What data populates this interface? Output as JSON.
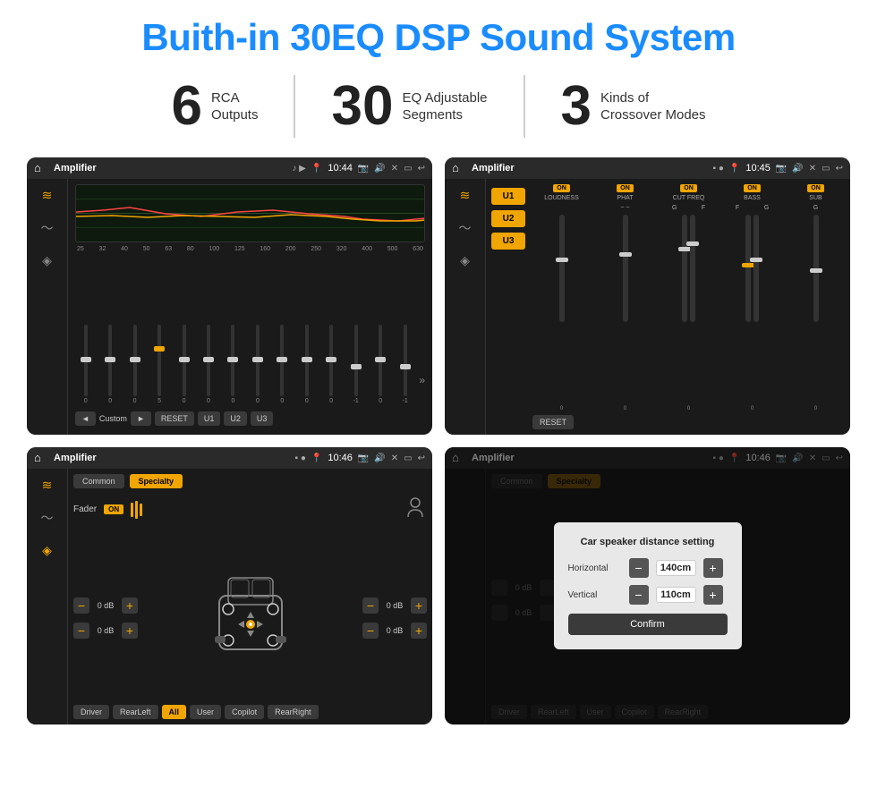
{
  "page": {
    "title": "Buith-in 30EQ DSP Sound System",
    "stats": [
      {
        "number": "6",
        "label": "RCA\nOutputs"
      },
      {
        "number": "30",
        "label": "EQ Adjustable\nSegments"
      },
      {
        "number": "3",
        "label": "Kinds of\nCrossover Modes"
      }
    ]
  },
  "screen1": {
    "statusTitle": "Amplifier",
    "time": "10:44",
    "freqLabels": [
      "25",
      "32",
      "40",
      "50",
      "63",
      "80",
      "100",
      "125",
      "160",
      "200",
      "250",
      "320",
      "400",
      "500",
      "630"
    ],
    "sliderValues": [
      "0",
      "0",
      "0",
      "5",
      "0",
      "0",
      "0",
      "0",
      "0",
      "0",
      "0",
      "-1",
      "0",
      "-1"
    ],
    "buttons": [
      "◄",
      "Custom",
      "►",
      "RESET",
      "U1",
      "U2",
      "U3"
    ]
  },
  "screen2": {
    "statusTitle": "Amplifier",
    "time": "10:45",
    "presets": [
      "U1",
      "U2",
      "U3"
    ],
    "channels": [
      "LOUDNESS",
      "PHAT",
      "CUT FREQ",
      "BASS",
      "SUB"
    ],
    "toggleState": "ON",
    "resetBtn": "RESET"
  },
  "screen3": {
    "statusTitle": "Amplifier",
    "time": "10:46",
    "tabs": [
      "Common",
      "Specialty"
    ],
    "activeTab": "Specialty",
    "faderLabel": "Fader",
    "faderOn": "ON",
    "dbValues": [
      "0 dB",
      "0 dB",
      "0 dB",
      "0 dB"
    ],
    "buttons": [
      "Driver",
      "RearLeft",
      "All",
      "User",
      "Copilot",
      "RearRight"
    ]
  },
  "screen4": {
    "statusTitle": "Amplifier",
    "time": "10:46",
    "tabs": [
      "Common",
      "Specialty"
    ],
    "dialog": {
      "title": "Car speaker distance setting",
      "horizontal": {
        "label": "Horizontal",
        "value": "140cm"
      },
      "vertical": {
        "label": "Vertical",
        "value": "110cm"
      },
      "confirmBtn": "Confirm"
    },
    "dbValues": [
      "0 dB",
      "0 dB"
    ],
    "buttons": [
      "Driver",
      "RearLeft",
      "All",
      "User",
      "Copilot",
      "RearRight"
    ]
  },
  "icons": {
    "home": "⌂",
    "back": "↩",
    "location": "📍",
    "speaker": "🔊",
    "eq": "≋",
    "wave": "〜",
    "volume": "◈",
    "arrow_right": "▶",
    "arrow_left": "◀",
    "arrow_up": "▲",
    "arrow_down": "▼",
    "person": "👤",
    "minus": "−",
    "plus": "+"
  }
}
